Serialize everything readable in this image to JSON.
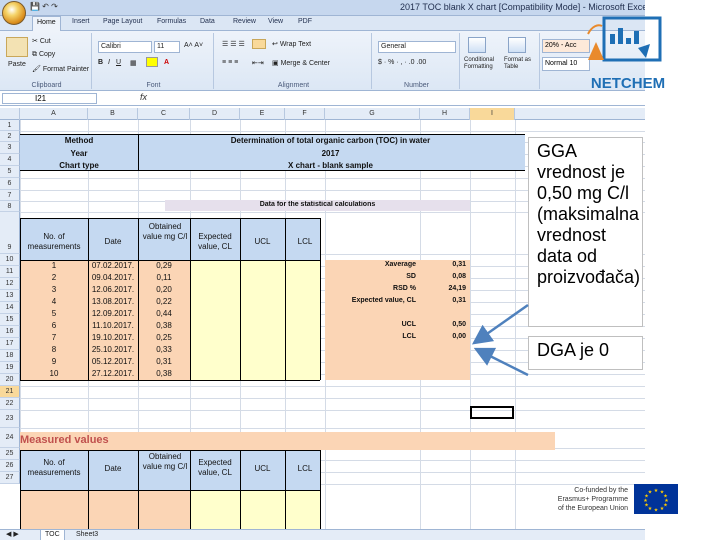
{
  "window": {
    "title": "2017 TOC blank X chart  [Compatibility Mode] - Microsoft Excel"
  },
  "tabs": [
    "Home",
    "Insert",
    "Page Layout",
    "Formulas",
    "Data",
    "Review",
    "View",
    "PDF"
  ],
  "ribbon": {
    "paste": "Paste",
    "cut": "Cut",
    "copy": "Copy",
    "format_painter": "Format Painter",
    "clipboard": "Clipboard",
    "font_name": "Calibri",
    "font_size": "11",
    "font_group": "Font",
    "wrap_text": "Wrap Text",
    "merge_center": "Merge & Center",
    "alignment": "Alignment",
    "number_format": "General",
    "number": "Number",
    "conditional_formatting": "Conditional Formatting",
    "format_as_table": "Format as Table",
    "style_20": "20% - Acc",
    "style_normal": "Normal 10"
  },
  "formula_bar": {
    "name_box": "I21",
    "fx": "fx"
  },
  "columns": [
    "A",
    "B",
    "C",
    "D",
    "E",
    "F",
    "G",
    "H",
    "I"
  ],
  "rows": [
    "1",
    "2",
    "3",
    "4",
    "5",
    "6",
    "7",
    "8",
    "9",
    "10",
    "11",
    "12",
    "13",
    "14",
    "15",
    "16",
    "17",
    "18",
    "19",
    "20",
    "21",
    "22",
    "23",
    "24",
    "25",
    "26",
    "27"
  ],
  "sheet": {
    "method_label": "Method",
    "method_value": "Determination of total organic carbon (TOC) in water",
    "year_label": "Year",
    "year_value": "2017",
    "chart_type_label": "Chart type",
    "chart_type_value": "X chart - blank sample",
    "stats_title": "Data for the statistical calculations",
    "headers": [
      "No. of measurements",
      "Date",
      "Obtained value mg C/l",
      "Expected value, CL",
      "UCL",
      "LCL"
    ],
    "measurements": [
      {
        "no": "1",
        "date": "07.02.2017.",
        "value": "0,29"
      },
      {
        "no": "2",
        "date": "09.04.2017.",
        "value": "0,11"
      },
      {
        "no": "3",
        "date": "12.06.2017.",
        "value": "0,20"
      },
      {
        "no": "4",
        "date": "13.08.2017.",
        "value": "0,22"
      },
      {
        "no": "5",
        "date": "12.09.2017.",
        "value": "0,44"
      },
      {
        "no": "6",
        "date": "11.10.2017.",
        "value": "0,38"
      },
      {
        "no": "7",
        "date": "19.10.2017.",
        "value": "0,25"
      },
      {
        "no": "8",
        "date": "25.10.2017.",
        "value": "0,33"
      },
      {
        "no": "9",
        "date": "05.12.2017.",
        "value": "0,31"
      },
      {
        "no": "10",
        "date": "27.12.2017.",
        "value": "0,38"
      }
    ],
    "stats": [
      {
        "label": "X̄average",
        "value": "0,31"
      },
      {
        "label": "SD",
        "value": "0,08"
      },
      {
        "label": "RSD %",
        "value": "24,19"
      },
      {
        "label": "Expected value, CL",
        "value": "0,31"
      },
      {
        "label": "UCL",
        "value": "0,50"
      },
      {
        "label": "LCL",
        "value": "0,00"
      }
    ],
    "measured_title": "Measured values",
    "measured_headers": [
      "No. of measurements",
      "Date",
      "Obtained value mg C/l",
      "Expected value, CL",
      "UCL",
      "LCL"
    ]
  },
  "sheet_tabs": [
    "TOC",
    "Sheet3"
  ],
  "callouts": {
    "gga": "GGA vrednost je 0,50 mg C/l (maksimalna vrednost data od proizvođača)",
    "dga": "DGA je 0"
  },
  "logo": {
    "text": "NETCHEM"
  },
  "eu": {
    "line1": "Co-funded by the",
    "line2": "Erasmus+ Programme",
    "line3": "of the European Union"
  },
  "colors": {
    "blue_band": "#c5d9f1",
    "orange_band": "#fbd5b5",
    "yellow_band": "#ffffcc",
    "measured_title": "#c0504d",
    "logo_blue": "#1f6fb5"
  }
}
